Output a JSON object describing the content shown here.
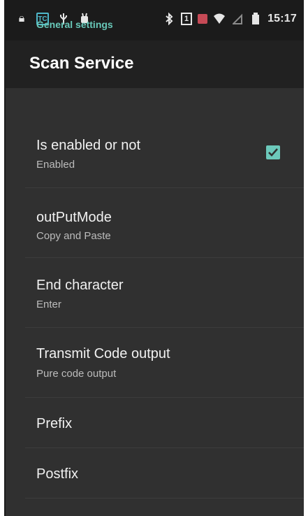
{
  "status_bar": {
    "time": "15:17",
    "sim_label": "1",
    "app_badge": "TC",
    "icons": [
      "lock-icon",
      "app-badge-icon",
      "usb-icon",
      "android-debug-icon",
      "bluetooth-icon",
      "sim-icon",
      "red-square-icon",
      "wifi-icon",
      "no-signal-icon",
      "battery-icon"
    ]
  },
  "app_bar": {
    "title": "Scan Service"
  },
  "section_header": "General settings",
  "settings": [
    {
      "label": "Is enabled or not",
      "summary": "Enabled",
      "checked": true
    },
    {
      "label": "outPutMode",
      "summary": "Copy and Paste"
    },
    {
      "label": "End character",
      "summary": "Enter"
    },
    {
      "label": "Transmit Code output",
      "summary": "Pure code output"
    },
    {
      "label": "Prefix"
    },
    {
      "label": "Postfix"
    }
  ],
  "colors": {
    "accent": "#68c8b9",
    "background": "#303030",
    "app_bar": "#212121",
    "status_bar": "#1b1b1b"
  }
}
